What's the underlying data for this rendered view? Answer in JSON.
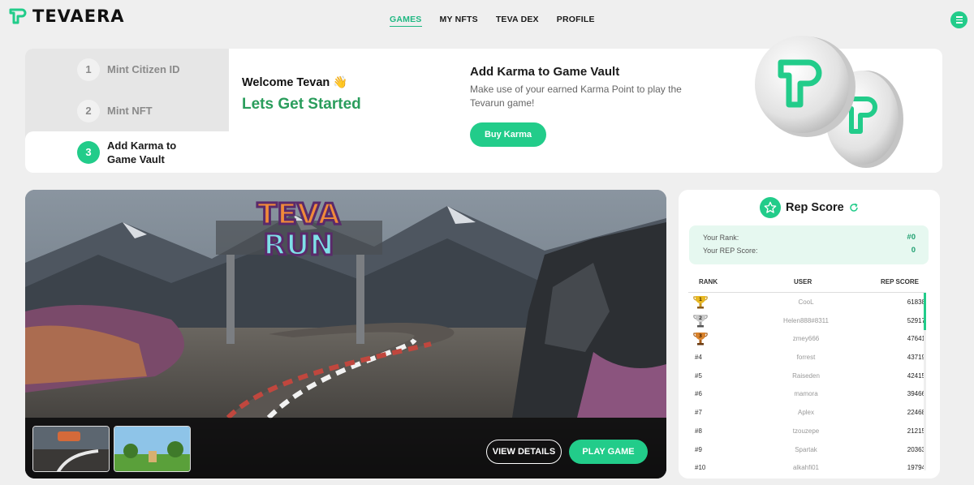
{
  "header": {
    "logo_text": "TEVAERA",
    "nav": [
      "GAMES",
      "MY NFTS",
      "TEVA DEX",
      "PROFILE"
    ],
    "active_nav": "GAMES"
  },
  "steps": [
    {
      "num": "1",
      "label": "Mint Citizen ID"
    },
    {
      "num": "2",
      "label": "Mint NFT"
    },
    {
      "num": "3",
      "label": "Add Karma to Game Vault"
    }
  ],
  "welcome": {
    "greeting": "Welcome Tevan 👋",
    "subtitle": "Lets Get Started"
  },
  "karma": {
    "title": "Add Karma to Game Vault",
    "description": "Make use of your earned Karma Point to play the Tevarun game!",
    "button": "Buy Karma"
  },
  "game": {
    "logo_line1": "TEVA",
    "logo_line2": "RUN",
    "view_button": "VIEW DETAILS",
    "play_button": "PLAY GAME"
  },
  "rep": {
    "title": "Rep Score",
    "rank_label": "Your Rank:",
    "rank_value": "#0",
    "score_label": "Your REP Score:",
    "score_value": "0",
    "columns": [
      "RANK",
      "USER",
      "REP SCORE"
    ],
    "rows": [
      {
        "rank": "1",
        "user": "CooL",
        "score": "61838"
      },
      {
        "rank": "2",
        "user": "Helen888#8311",
        "score": "52917"
      },
      {
        "rank": "3",
        "user": "zmey666",
        "score": "47641"
      },
      {
        "rank": "#4",
        "user": "forrest",
        "score": "43719"
      },
      {
        "rank": "#5",
        "user": "Raiseden",
        "score": "42415"
      },
      {
        "rank": "#6",
        "user": "mamora",
        "score": "39466"
      },
      {
        "rank": "#7",
        "user": "Aplex",
        "score": "22468"
      },
      {
        "rank": "#8",
        "user": "tzouzepe",
        "score": "21215"
      },
      {
        "rank": "#9",
        "user": "Spartak",
        "score": "20363"
      },
      {
        "rank": "#10",
        "user": "alkahfi01",
        "score": "19794"
      }
    ]
  },
  "colors": {
    "accent": "#22cc8a",
    "green_text": "#2a9d5c"
  },
  "icons": [
    "tevaera-logo-icon",
    "menu-icon",
    "star-icon",
    "refresh-icon",
    "trophy-gold-icon",
    "trophy-silver-icon",
    "trophy-bronze-icon"
  ]
}
